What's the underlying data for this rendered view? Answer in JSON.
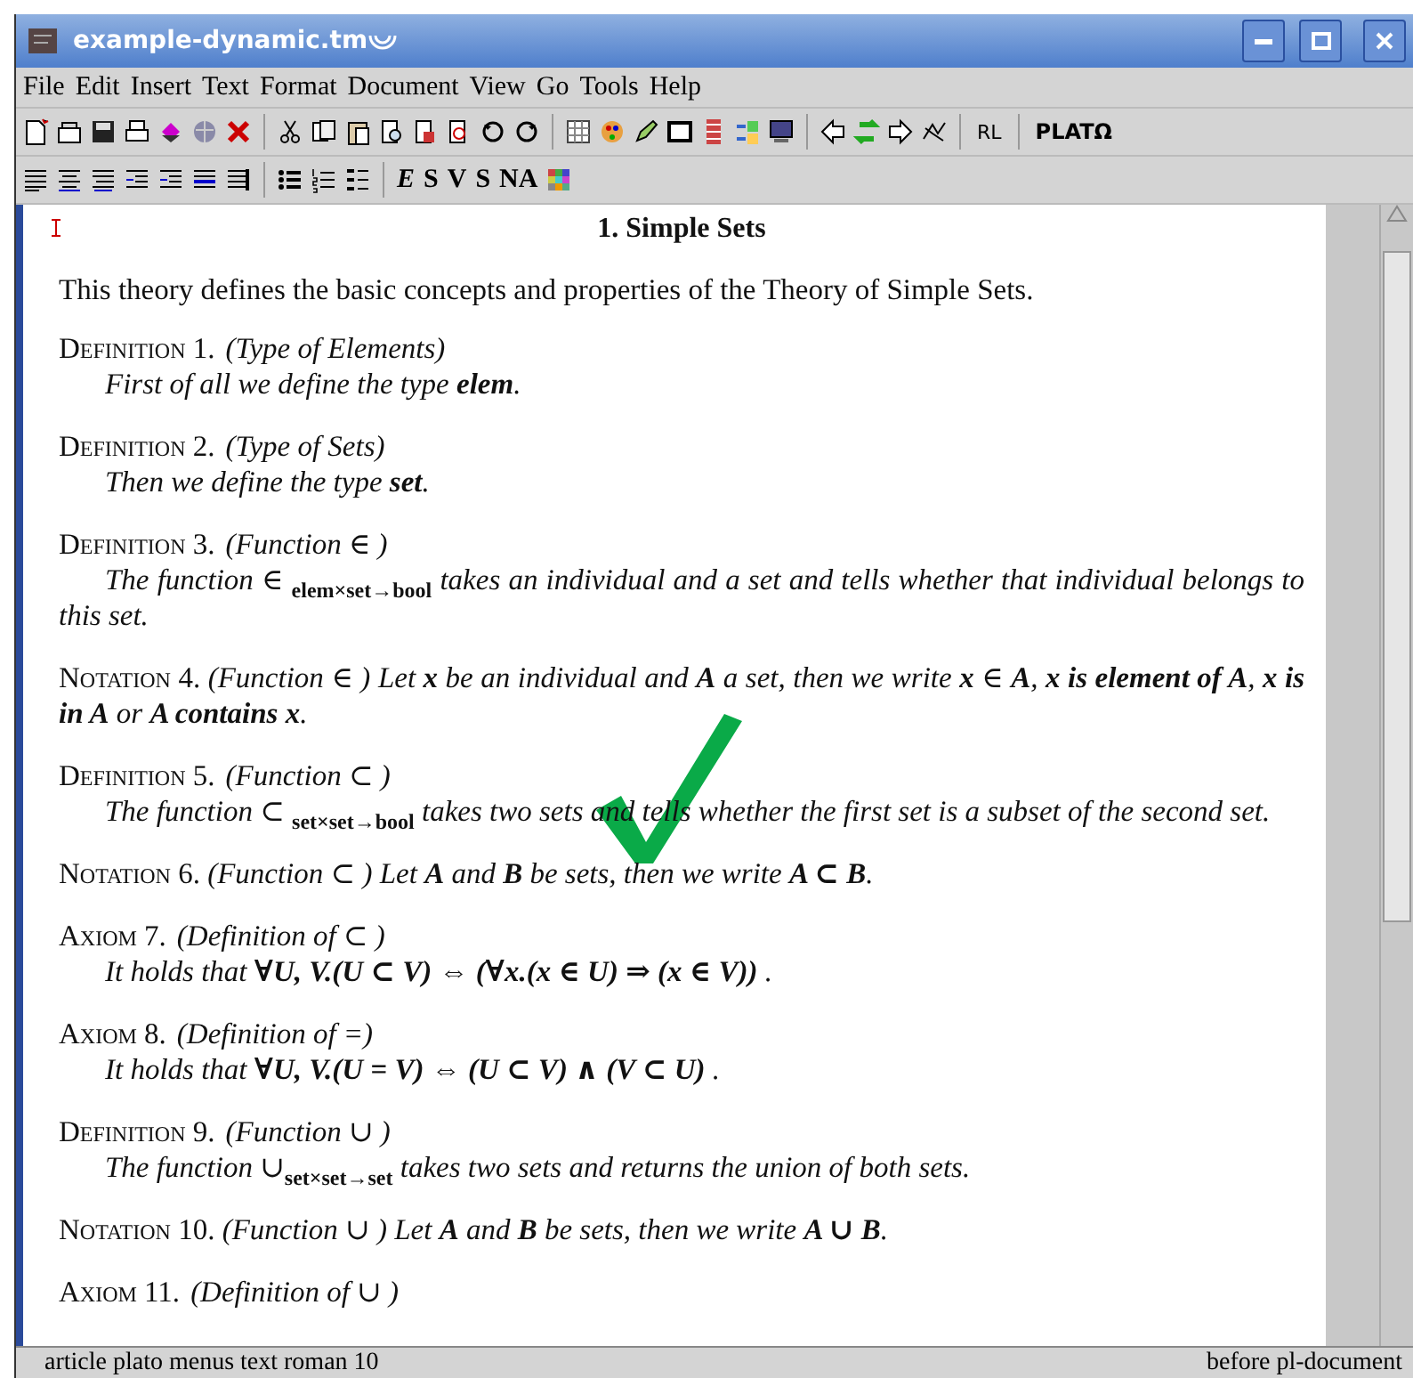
{
  "window": {
    "title": "example-dynamic.tm"
  },
  "menu": [
    "File",
    "Edit",
    "Insert",
    "Text",
    "Format",
    "Document",
    "View",
    "Go",
    "Tools",
    "Help"
  ],
  "toolbar": {
    "text_buttons": [
      "RL",
      "PLATΩ"
    ]
  },
  "format_bar": {
    "style_buttons": [
      "E",
      "S",
      "V",
      "S",
      "NA"
    ]
  },
  "document": {
    "section_title": "1.  Simple Sets",
    "intro": "This theory defines the basic concepts and properties of the Theory of Simple Sets.",
    "blocks": [
      {
        "kind": "definition",
        "label": "Definition 1.",
        "title": "(Type of Elements)",
        "body": "First of all we define the type **elem**."
      },
      {
        "kind": "definition",
        "label": "Definition 2.",
        "title": "(Type of Sets)",
        "body": "Then we define the type **set**."
      },
      {
        "kind": "definition",
        "label": "Definition 3.",
        "title": "(Function ∈ )",
        "body": "The function  ∈ $_{elem×set→bool}$ takes an individual and a set and tells whether that individual belongs to this set."
      },
      {
        "kind": "notation",
        "label": "Notation 4.",
        "title": "(Function ∈ )",
        "body": "Let **x** be an individual and **A** a set, then we write **x** ∈ **A**, **x is element of A**, **x is in A** or **A contains x**."
      },
      {
        "kind": "definition",
        "label": "Definition 5.",
        "title": "(Function ⊂ )",
        "body": "The function  ⊂ $_{set×set→bool}$ takes two sets and tells whether the first set is a subset of the second set."
      },
      {
        "kind": "notation",
        "label": "Notation 6.",
        "title": "(Function ⊂ )",
        "body": "Let **A** and **B** be sets, then we write **A ⊂ B**."
      },
      {
        "kind": "definition",
        "label": "Axiom 7.",
        "title": "(Definition of ⊂ )",
        "body": "It holds that **∀U, V.(U ⊂ V) ⇔ (∀x.(x ∈ U) ⇒ (x ∈ V))** ."
      },
      {
        "kind": "definition",
        "label": "Axiom 8.",
        "title": "(Definition of =)",
        "body": "It holds that **∀U, V.(U = V) ⇔ (U ⊂ V) ∧ (V ⊂ U)** ."
      },
      {
        "kind": "definition",
        "label": "Definition 9.",
        "title": "(Function ∪ )",
        "body": "The function ∪$_{set×set→set}$ takes two sets and returns the union of both sets."
      },
      {
        "kind": "notation",
        "label": "Notation 10.",
        "title": "(Function ∪ )",
        "body": "Let **A** and **B** be sets, then we write **A ∪ B**."
      },
      {
        "kind": "heading",
        "label": "Axiom 11.",
        "title": "(Definition of ∪ )"
      }
    ]
  },
  "status_bar": {
    "left": "article plato menus text roman 10",
    "right": "before pl-document"
  }
}
